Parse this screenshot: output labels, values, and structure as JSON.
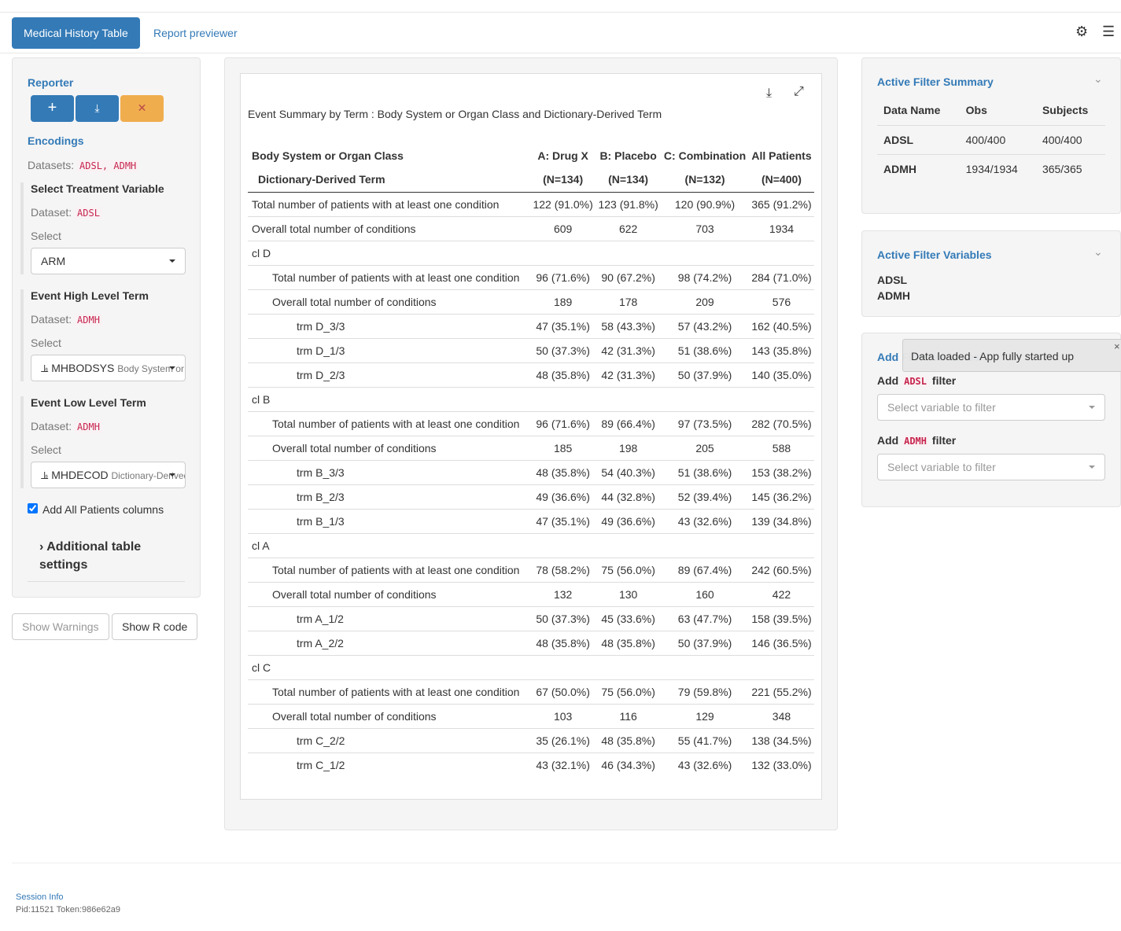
{
  "nav": {
    "tabs": [
      "Medical History Table",
      "Report previewer"
    ],
    "icons": [
      "gear-icon",
      "hamburger-menu-icon"
    ]
  },
  "left": {
    "reporter": "Reporter",
    "reporter_buttons": [
      "plus-icon",
      "download-icon",
      "close-icon"
    ],
    "encodings": "Encodings",
    "datasets_label": "Datasets:",
    "datasets": "ADSL, ADMH",
    "groups": [
      {
        "title": "Select Treatment Variable",
        "dataset_label": "Dataset:",
        "dataset": "ADSL",
        "select_label": "Select",
        "value": "ARM",
        "desc": ""
      },
      {
        "title": "Event High Level Term",
        "dataset_label": "Dataset:",
        "dataset": "ADMH",
        "select_label": "Select",
        "value": "MHBODSYS",
        "desc": "Body System or Organ Class"
      },
      {
        "title": "Event Low Level Term",
        "dataset_label": "Dataset:",
        "dataset": "ADMH",
        "select_label": "Select",
        "value": "MHDECOD",
        "desc": "Dictionary-Derived Term"
      }
    ],
    "all_patients_label": "Add All Patients columns",
    "all_patients_checked": true,
    "additional": "Additional table settings",
    "show_warnings": "Show Warnings",
    "show_r_code": "Show R code"
  },
  "main": {
    "title": "Event Summary by Term : Body System or Organ Class and Dictionary-Derived Term",
    "header1": [
      "Body System or Organ Class",
      "A: Drug X",
      "B: Placebo",
      "C: Combination",
      "All Patients"
    ],
    "header2": [
      "Dictionary-Derived Term",
      "(N=134)",
      "(N=134)",
      "(N=132)",
      "(N=400)"
    ],
    "rows": [
      {
        "indent": 0,
        "cells": [
          "Total number of patients with at least one condition",
          "122 (91.0%)",
          "123 (91.8%)",
          "120 (90.9%)",
          "365 (91.2%)"
        ]
      },
      {
        "indent": 0,
        "cells": [
          "Overall total number of conditions",
          "609",
          "622",
          "703",
          "1934"
        ]
      },
      {
        "indent": 0,
        "cells": [
          "cl D",
          "",
          "",
          "",
          ""
        ]
      },
      {
        "indent": 1,
        "cells": [
          "Total number of patients with at least one condition",
          "96 (71.6%)",
          "90 (67.2%)",
          "98 (74.2%)",
          "284 (71.0%)"
        ]
      },
      {
        "indent": 1,
        "cells": [
          "Overall total number of conditions",
          "189",
          "178",
          "209",
          "576"
        ]
      },
      {
        "indent": 2,
        "cells": [
          "trm D_3/3",
          "47 (35.1%)",
          "58 (43.3%)",
          "57 (43.2%)",
          "162 (40.5%)"
        ]
      },
      {
        "indent": 2,
        "cells": [
          "trm D_1/3",
          "50 (37.3%)",
          "42 (31.3%)",
          "51 (38.6%)",
          "143 (35.8%)"
        ]
      },
      {
        "indent": 2,
        "cells": [
          "trm D_2/3",
          "48 (35.8%)",
          "42 (31.3%)",
          "50 (37.9%)",
          "140 (35.0%)"
        ]
      },
      {
        "indent": 0,
        "cells": [
          "cl B",
          "",
          "",
          "",
          ""
        ]
      },
      {
        "indent": 1,
        "cells": [
          "Total number of patients with at least one condition",
          "96 (71.6%)",
          "89 (66.4%)",
          "97 (73.5%)",
          "282 (70.5%)"
        ]
      },
      {
        "indent": 1,
        "cells": [
          "Overall total number of conditions",
          "185",
          "198",
          "205",
          "588"
        ]
      },
      {
        "indent": 2,
        "cells": [
          "trm B_3/3",
          "48 (35.8%)",
          "54 (40.3%)",
          "51 (38.6%)",
          "153 (38.2%)"
        ]
      },
      {
        "indent": 2,
        "cells": [
          "trm B_2/3",
          "49 (36.6%)",
          "44 (32.8%)",
          "52 (39.4%)",
          "145 (36.2%)"
        ]
      },
      {
        "indent": 2,
        "cells": [
          "trm B_1/3",
          "47 (35.1%)",
          "49 (36.6%)",
          "43 (32.6%)",
          "139 (34.8%)"
        ]
      },
      {
        "indent": 0,
        "cells": [
          "cl A",
          "",
          "",
          "",
          ""
        ]
      },
      {
        "indent": 1,
        "cells": [
          "Total number of patients with at least one condition",
          "78 (58.2%)",
          "75 (56.0%)",
          "89 (67.4%)",
          "242 (60.5%)"
        ]
      },
      {
        "indent": 1,
        "cells": [
          "Overall total number of conditions",
          "132",
          "130",
          "160",
          "422"
        ]
      },
      {
        "indent": 2,
        "cells": [
          "trm A_1/2",
          "50 (37.3%)",
          "45 (33.6%)",
          "63 (47.7%)",
          "158 (39.5%)"
        ]
      },
      {
        "indent": 2,
        "cells": [
          "trm A_2/2",
          "48 (35.8%)",
          "48 (35.8%)",
          "50 (37.9%)",
          "146 (36.5%)"
        ]
      },
      {
        "indent": 0,
        "cells": [
          "cl C",
          "",
          "",
          "",
          ""
        ]
      },
      {
        "indent": 1,
        "cells": [
          "Total number of patients with at least one condition",
          "67 (50.0%)",
          "75 (56.0%)",
          "79 (59.8%)",
          "221 (55.2%)"
        ]
      },
      {
        "indent": 1,
        "cells": [
          "Overall total number of conditions",
          "103",
          "116",
          "129",
          "348"
        ]
      },
      {
        "indent": 2,
        "cells": [
          "trm C_2/2",
          "35 (26.1%)",
          "48 (35.8%)",
          "55 (41.7%)",
          "138 (34.5%)"
        ]
      },
      {
        "indent": 2,
        "cells": [
          "trm C_1/2",
          "43 (32.1%)",
          "46 (34.3%)",
          "43 (32.6%)",
          "132 (33.0%)"
        ]
      }
    ]
  },
  "right": {
    "summary_title": "Active Filter Summary",
    "summary_headers": [
      "Data Name",
      "Obs",
      "Subjects"
    ],
    "summary_rows": [
      [
        "ADSL",
        "400/400",
        "400/400"
      ],
      [
        "ADMH",
        "1934/1934",
        "365/365"
      ]
    ],
    "vars_title": "Active Filter Variables",
    "vars": [
      "ADSL",
      "ADMH"
    ],
    "add_title": "Add Filter Variables",
    "filters": [
      {
        "pre": "Add",
        "ds": "ADSL",
        "post": "filter",
        "placeholder": "Select variable to filter"
      },
      {
        "pre": "Add",
        "ds": "ADMH",
        "post": "filter",
        "placeholder": "Select variable to filter"
      }
    ],
    "notification": "Data loaded - App fully started up"
  },
  "footer": {
    "session": "Session Info",
    "pid": "Pid:11521 Token:986e62a9"
  }
}
